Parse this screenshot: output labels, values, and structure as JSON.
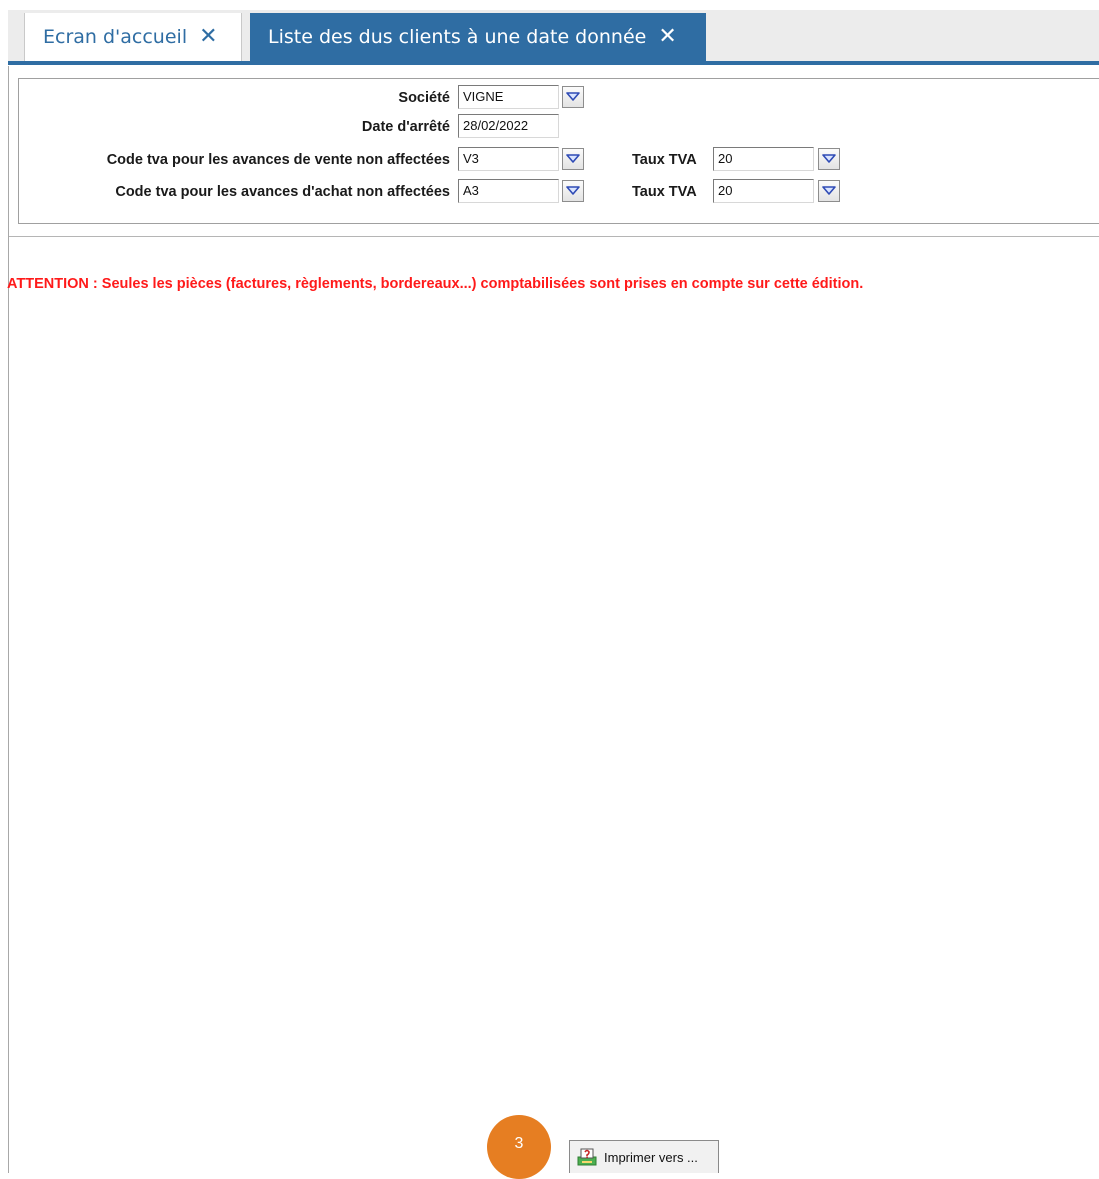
{
  "tabs": [
    {
      "label": "Ecran d'accueil",
      "active": false
    },
    {
      "label": "Liste des dus clients à une date donnée",
      "active": true
    }
  ],
  "form": {
    "societe_label": "Société",
    "societe_value": "VIGNE",
    "date_label": "Date d'arrêté",
    "date_value": "28/02/2022",
    "vente_label": "Code tva pour les avances de vente non affectées",
    "vente_value": "V3",
    "vente_taux_label": "Taux TVA",
    "vente_taux_value": "20",
    "achat_label": "Code tva pour les avances d'achat non affectées",
    "achat_value": "A3",
    "achat_taux_label": "Taux TVA",
    "achat_taux_value": "20"
  },
  "warning": "ATTENTION : Seules les pièces (factures, règlements, bordereaux...) comptabilisées sont prises en compte sur cette édition.",
  "step_marker": "3",
  "print_button": {
    "label": "Imprimer vers ...",
    "icon": "printer-icon"
  },
  "colors": {
    "accent": "#2f6da3",
    "warning": "#ff1a1a",
    "step_marker": "#e67e22"
  },
  "icons": {
    "tab_close": "close-icon",
    "dropdown": "chevron-down-icon"
  }
}
